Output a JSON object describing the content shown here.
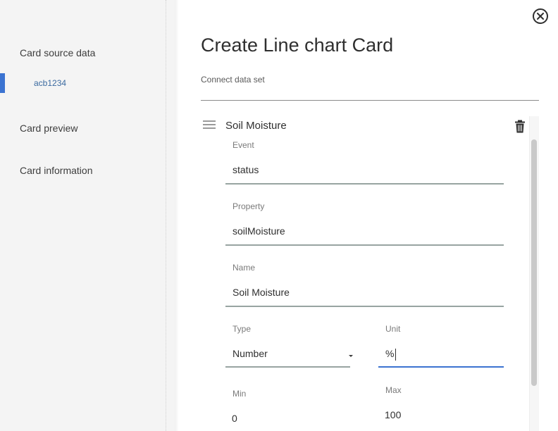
{
  "sidebar": {
    "items": [
      {
        "label": "Card source data"
      },
      {
        "label": "acb1234"
      },
      {
        "label": "Card preview"
      },
      {
        "label": "Card information"
      }
    ],
    "active_color": "#3b73d1"
  },
  "header": {
    "title": "Create Line chart Card",
    "subtitle": "Connect data set"
  },
  "dataset": {
    "title": "Soil Moisture",
    "fields": {
      "event": {
        "label": "Event",
        "value": "status"
      },
      "property": {
        "label": "Property",
        "value": "soilMoisture"
      },
      "name": {
        "label": "Name",
        "value": "Soil Moisture"
      },
      "type": {
        "label": "Type",
        "value": "Number"
      },
      "unit": {
        "label": "Unit",
        "value": "%"
      },
      "min": {
        "label": "Min",
        "value": "0"
      },
      "max": {
        "label": "Max",
        "value": "100"
      }
    }
  },
  "icons": {
    "close": "close-circle-icon",
    "drag": "drag-handle-icon",
    "delete": "trash-icon",
    "dropdown": "caret-down-icon"
  },
  "colors": {
    "accent": "#3b73d1",
    "field_underline": "#98a4a1",
    "sidebar_bg": "#f4f4f4"
  }
}
